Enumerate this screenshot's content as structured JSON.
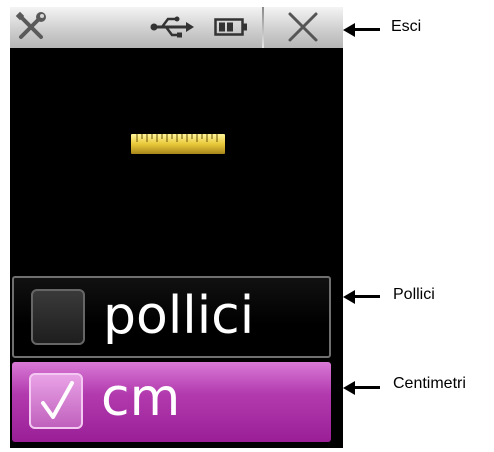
{
  "header": {
    "tools_icon": "tools-icon",
    "usb_icon": "usb-icon",
    "battery_icon": "battery-icon",
    "close_icon": "close-icon"
  },
  "illustration": {
    "icon": "ruler-icon"
  },
  "options": [
    {
      "label": "pollici",
      "checked": false
    },
    {
      "label": "cm",
      "checked": true
    }
  ],
  "callouts": {
    "exit": "Esci",
    "inches": "Pollici",
    "centimeters": "Centimetri"
  },
  "colors": {
    "selected_background": "#a62aa3",
    "screen_background": "#000000",
    "topbar": "#cfcfcf"
  }
}
